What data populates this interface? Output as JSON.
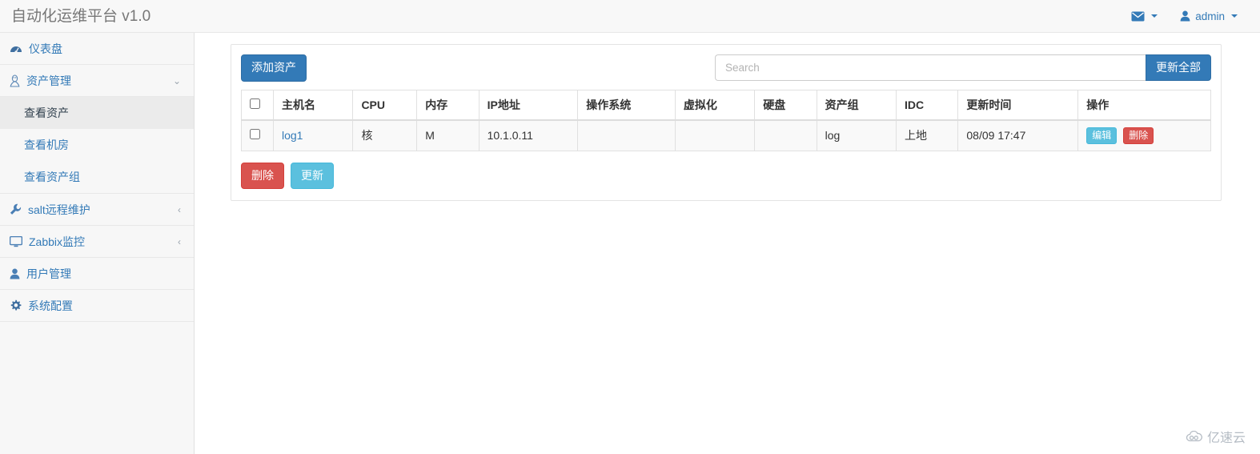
{
  "navbar": {
    "brand": "自动化运维平台 v1.0",
    "messages_icon": "envelope-icon",
    "user_icon": "user-icon",
    "user_label": "admin"
  },
  "sidebar": {
    "items": [
      {
        "icon": "dashboard-icon",
        "label": "仪表盘",
        "chevron": ""
      },
      {
        "icon": "linux-penguin-icon",
        "label": "资产管理",
        "chevron": "⌄"
      },
      {
        "icon": "wrench-icon",
        "label": "salt远程维护",
        "chevron": "‹"
      },
      {
        "icon": "desktop-icon",
        "label": "Zabbix监控",
        "chevron": "‹"
      },
      {
        "icon": "user-icon",
        "label": "用户管理",
        "chevron": ""
      },
      {
        "icon": "gear-icon",
        "label": "系统配置",
        "chevron": ""
      }
    ],
    "submenu": [
      {
        "label": "查看资产",
        "active": true
      },
      {
        "label": "查看机房",
        "active": false
      },
      {
        "label": "查看资产组",
        "active": false
      }
    ]
  },
  "toolbar": {
    "add_asset_label": "添加资产",
    "search_placeholder": "Search",
    "search_value": "",
    "update_all_label": "更新全部"
  },
  "table": {
    "headers": [
      "",
      "主机名",
      "CPU",
      "内存",
      "IP地址",
      "操作系统",
      "虚拟化",
      "硬盘",
      "资产组",
      "IDC",
      "更新时间",
      "操作"
    ],
    "rows": [
      {
        "hostname": "log1",
        "cpu": "核",
        "memory": "M",
        "ip": "10.1.0.11",
        "os": "",
        "virtualization": "",
        "disk": "",
        "asset_group": "log",
        "idc": "上地",
        "updated_at": "08/09 17:47",
        "edit_label": "编辑",
        "delete_label": "删除"
      }
    ]
  },
  "footer_buttons": {
    "delete_label": "删除",
    "update_label": "更新"
  },
  "watermark": {
    "icon": "cloud-icon",
    "text": "亿速云"
  },
  "colors": {
    "primary": "#337ab7",
    "danger": "#d9534f",
    "info": "#5bc0de",
    "navbar_bg": "#f8f8f8",
    "sidebar_bg": "#f7f7f7",
    "row_bg": "#f9f9f9"
  }
}
